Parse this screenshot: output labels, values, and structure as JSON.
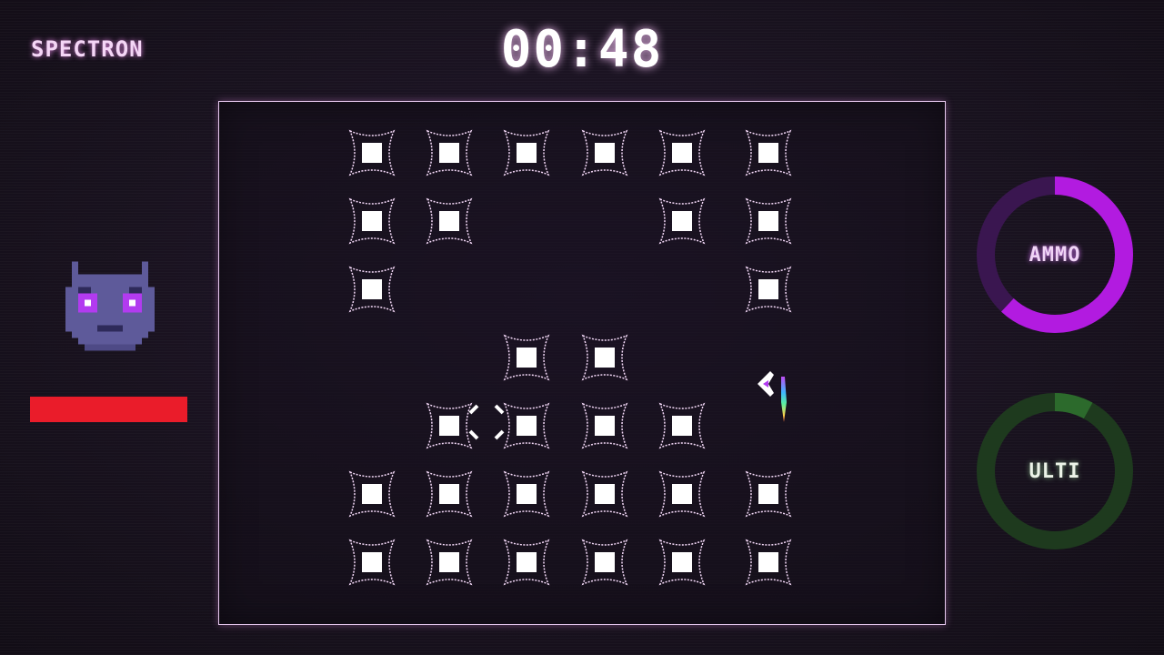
{
  "hud": {
    "logo": "SPECTRON",
    "timer": "00:48",
    "boss_health_fraction": 1.0
  },
  "gauges": {
    "ammo": {
      "label": "AMMO",
      "fill_fraction": 0.62,
      "color": "#b21be0",
      "track_color": "#3a1650"
    },
    "ulti": {
      "label": "ULTI",
      "fill_fraction": 0.08,
      "color": "#2c6a2c",
      "track_color": "#1e3a1e"
    }
  },
  "colors": {
    "health": "#ea1c2a",
    "block_outline": "#f3d8f7",
    "block_core": "#ffffff",
    "boss_face": "#5e5a9a",
    "boss_eyes": "#b23bf0"
  },
  "arena": {
    "grid_columns": 6,
    "grid_rows": 7,
    "blocks_by_row": [
      [
        0,
        1,
        2,
        3,
        4,
        5
      ],
      [
        0,
        1,
        4,
        5
      ],
      [
        0,
        5
      ],
      [
        2,
        3
      ],
      [
        1,
        2,
        3,
        4
      ],
      [
        0,
        1,
        2,
        3,
        4,
        5
      ],
      [
        0,
        1,
        2,
        3,
        4,
        5
      ]
    ]
  },
  "icons": {
    "player": "spaceship-icon",
    "crosshair": "crosshair-icon",
    "boss": "demon-face-icon"
  }
}
